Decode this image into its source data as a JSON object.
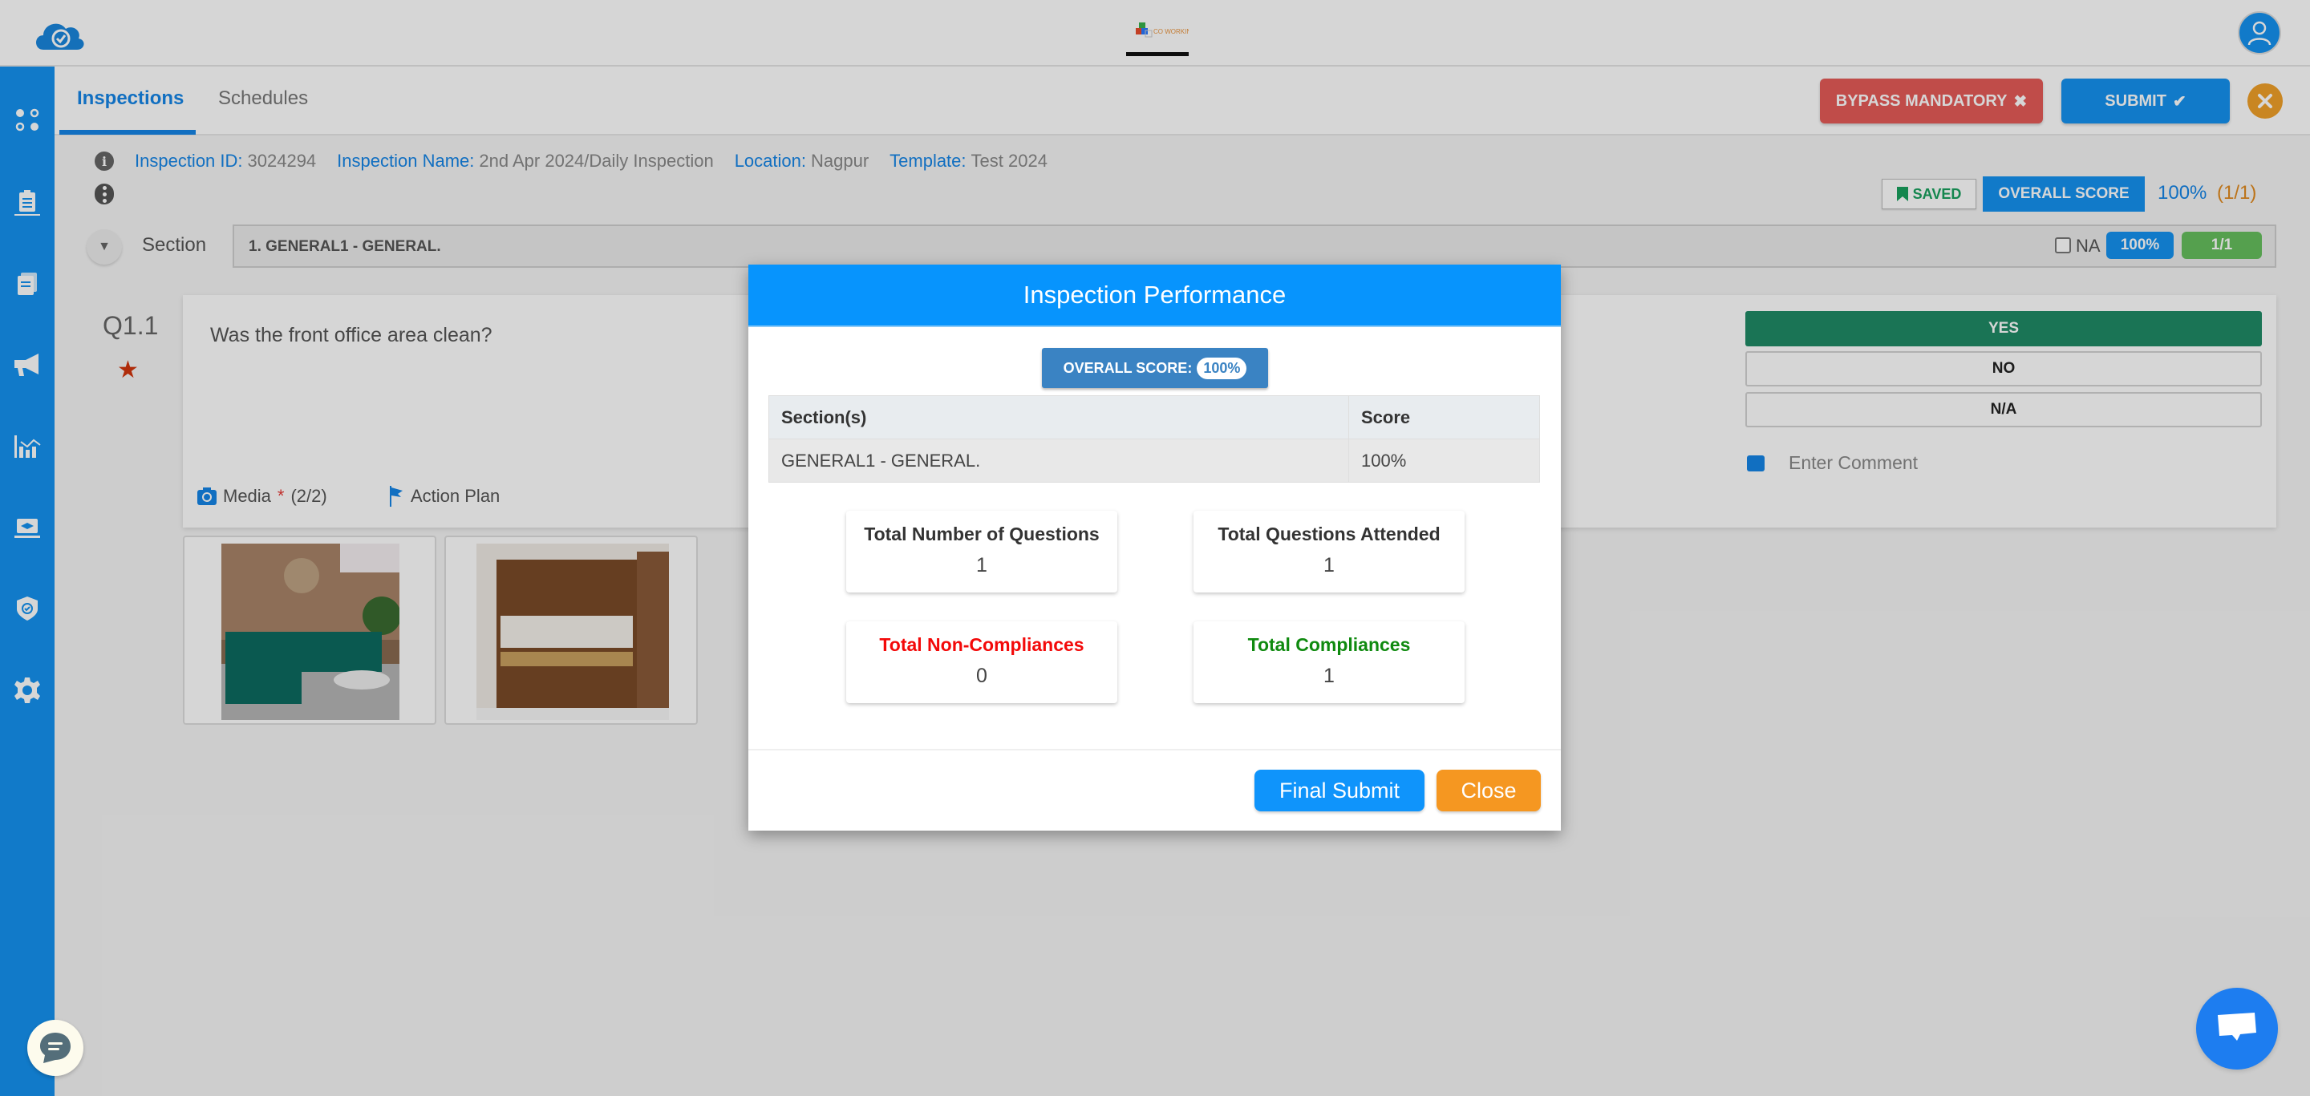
{
  "header": {
    "app_logo": "cloud-check-logo",
    "center_logo": "coworking-space-logo",
    "user": "user-avatar-icon"
  },
  "sidebar": {
    "items": [
      {
        "icon": "dashboard-dots-icon"
      },
      {
        "icon": "clipboard-icon"
      },
      {
        "icon": "documents-icon"
      },
      {
        "icon": "megaphone-icon"
      },
      {
        "icon": "analytics-chart-icon"
      },
      {
        "icon": "training-laptop-icon"
      },
      {
        "icon": "shield-check-icon"
      },
      {
        "icon": "gear-icon"
      }
    ]
  },
  "tabs": [
    {
      "label": "Inspections",
      "active": true
    },
    {
      "label": "Schedules",
      "active": false
    }
  ],
  "toolbar": {
    "bypass_label": "BYPASS MANDATORY",
    "bypass_icon": "✖",
    "submit_label": "SUBMIT",
    "submit_icon": "✔"
  },
  "inspection_info": {
    "id_label": "Inspection ID:",
    "id_value": "3024294",
    "name_label": "Inspection Name:",
    "name_value": "2nd Apr 2024/Daily Inspection",
    "location_label": "Location:",
    "location_value": "Nagpur",
    "template_label": "Template:",
    "template_value": "Test 2024"
  },
  "score_bar": {
    "saved_label": "SAVED",
    "overall_label": "OVERALL SCORE",
    "overall_pct": "100%",
    "overall_frac": "(1/1)"
  },
  "section": {
    "label": "Section",
    "name": "1. GENERAL1 - GENERAL.",
    "na_label": "NA",
    "pct": "100%",
    "frac": "1/1"
  },
  "question": {
    "number": "Q1.1",
    "text": "Was the front office area clean?",
    "media_label": "Media",
    "media_required": "*",
    "media_count": "(2/2)",
    "action_plan_label": "Action Plan",
    "answers": [
      "YES",
      "NO",
      "N/A"
    ],
    "selected_answer": "YES",
    "comment_placeholder": "Enter Comment",
    "attachments": [
      {
        "description": "living room with teal sofa"
      },
      {
        "description": "wooden wardrobe with bookshelf"
      }
    ]
  },
  "modal": {
    "title": "Inspection Performance",
    "overall_label": "OVERALL SCORE:",
    "overall_value": "100%",
    "table": {
      "headers": [
        "Section(s)",
        "Score"
      ],
      "rows": [
        [
          "GENERAL1 - GENERAL.",
          "100%"
        ]
      ]
    },
    "stats": [
      {
        "title": "Total Number of Questions",
        "value": "1"
      },
      {
        "title": "Total Questions Attended",
        "value": "1"
      },
      {
        "title": "Total Non-Compliances",
        "value": "0"
      },
      {
        "title": "Total Compliances",
        "value": "1"
      }
    ],
    "final_submit_label": "Final Submit",
    "close_label": "Close"
  },
  "colors": {
    "primary": "#1592f0",
    "modal_header": "#0794fd",
    "bypass": "#e55b58",
    "close": "#f59721",
    "yes": "#1f8b66",
    "non_compliance": "#f30909",
    "compliance": "#0f8a0f"
  }
}
